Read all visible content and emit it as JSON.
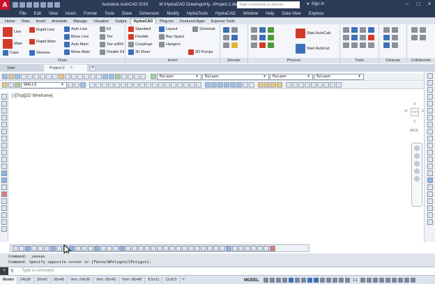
{
  "titlebar": {
    "app_name": "Autodesk AutoCAD 2019",
    "file_path": "M:\\HydraCAD Drawings\\Hy...\\Project 2.dwg",
    "search_placeholder": "Type a keyword or phrase",
    "sign_in": "Sign In"
  },
  "menu": [
    "File",
    "Edit",
    "View",
    "Insert",
    "Format",
    "Tools",
    "Draw",
    "Dimension",
    "Modify",
    "HydraTools",
    "HydraCAD",
    "Window",
    "Help",
    "Data View",
    "Express"
  ],
  "ribbon_tabs": [
    "Home",
    "View",
    "Insert",
    "Annotate",
    "Manage",
    "Visualize",
    "Output",
    "HydraCAD",
    "Plug-ins",
    "Featured Apps",
    "Express Tools"
  ],
  "active_ribbon_tab": "HydraCAD",
  "ribbon": {
    "draw": {
      "title": "Draw",
      "line": "Line",
      "rapid_line": "Rapid Line",
      "main": "Main",
      "rapid_main": "Rapid Main",
      "caps": "Caps",
      "sleeves": "Sleeves",
      "auto_line": "Auto Line",
      "move_line": "Move Line",
      "auto_main": "Auto Main",
      "move_main": "Move Main"
    },
    "insert": {
      "title": "Insert",
      "ell": "Ell",
      "tee": "Tee",
      "tee_wrn": "Tee w/RN",
      "double_ell": "Double Ell",
      "standard": "Standard",
      "flexible": "Flexible",
      "couplings": "Couplings",
      "riser_3d": "3D Riser",
      "layout": "Layout",
      "bay_space": "Bay Space",
      "hangers": "Hangers",
      "schedule": "Schedule",
      "pumps_3d": "3D Pumps"
    },
    "elevate": {
      "title": "Elevate"
    },
    "process": {
      "title": "Process",
      "start_autocalc": "Start AutoCalc",
      "start_autolist": "Start AutoList"
    },
    "tools": {
      "title": "Tools"
    },
    "cleanup": {
      "title": "Cleanup"
    },
    "collaborate": {
      "title": "Collaborate"
    }
  },
  "doc_tabs": {
    "start": "Start",
    "active": "Project 2",
    "close": "×",
    "add": "+"
  },
  "layers_toolbar": {
    "current_layer": "WALLS",
    "color": "ByLayer",
    "linetype": "ByLayer",
    "lineweight": "ByLayer",
    "plotstyle": "ByLayer"
  },
  "viewport": {
    "label": "[-][Top][2D Wireframe]",
    "viewcube": {
      "north": "N",
      "west": "W",
      "east": "E",
      "south": "S",
      "face": "TOP",
      "wcs": "WCS"
    }
  },
  "command": {
    "history": [
      "Command: _saveas",
      "Command: Specify opposite corner or [Fence/WPolygon/CPolygon]:"
    ],
    "placeholder": "Type a command"
  },
  "status": {
    "tabs": [
      "Model",
      "24x36",
      "30x42",
      "36x48",
      "Vert -24x36",
      "Vert -30x42",
      "Vert -36x48",
      "8.5x11",
      "11x8.5"
    ],
    "active_tab": "Model",
    "add": "+",
    "mode": "MODEL",
    "scale": "1:1"
  },
  "colors": {
    "titlebar": "#2b3a55",
    "ribbon_bg": "#f4f6f9",
    "accent_red": "#c8102e"
  }
}
